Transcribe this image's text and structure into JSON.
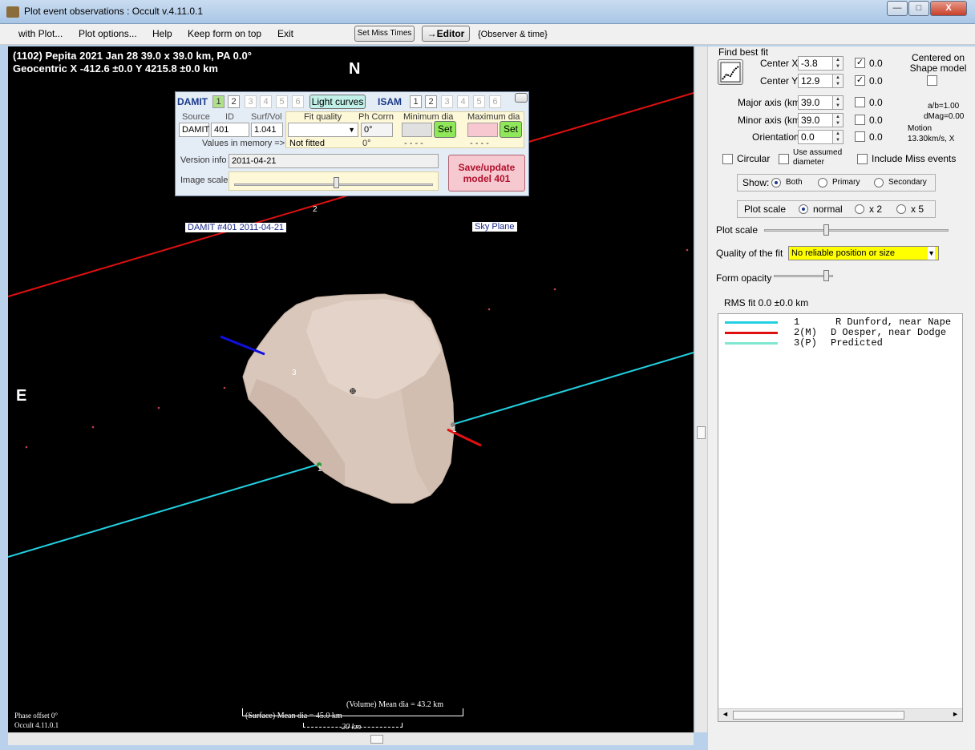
{
  "window": {
    "title": "Plot event observations : Occult v.4.11.0.1",
    "minimize": "—",
    "maximize": "□",
    "close": "X"
  },
  "menu": {
    "items": [
      "with Plot...",
      "Plot options...",
      "Help",
      "Keep form on top",
      "Exit"
    ],
    "set_miss_times": "Set Miss Times",
    "editor": "→Editor",
    "observer_time": "{Observer & time}"
  },
  "plot": {
    "header_line1": "(1102) Pepita  2021 Jan 28   39.0 x 39.0 km, PA 0.0°",
    "header_line2": "Geocentric  X  -412.6 ±0.0  Y 4215.8 ±0.0 km",
    "north": "N",
    "east": "E",
    "damit_label": "DAMIT #401 2011-04-21",
    "sky_plane": "Sky Plane",
    "chord_labels": [
      "1",
      "1",
      "2",
      "3"
    ],
    "phase_offset": "Phase offset 0°",
    "version": "Occult 4.11.0.1",
    "volume_mean": "(Volume) Mean dia = 43.2 km",
    "surface_mean": "(Surface) Mean dia = 45.0 km",
    "scale_bar": "20 km",
    "colors": {
      "chord1": "#22d0e0",
      "chord2": "#e01010",
      "predicted": "#7fe8d0",
      "asteroid": "#dac7bc"
    }
  },
  "damit_panel": {
    "damit_label": "DAMIT",
    "isam_label": "ISAM",
    "damit_nums": [
      "1",
      "2",
      "3",
      "4",
      "5",
      "6"
    ],
    "isam_nums": [
      "1",
      "2",
      "3",
      "4",
      "5",
      "6"
    ],
    "light_curves": "Light curves",
    "col_source": "Source",
    "col_id": "ID",
    "col_surfvol": "Surf/Vol",
    "col_fitq": "Fit quality",
    "col_phcorr": "Ph Corrn",
    "col_mindia": "Minimum dia",
    "col_maxdia": "Maximum dia",
    "source_val": "DAMIT",
    "id_val": "401",
    "surfvol_val": "1.041",
    "ph_val": "0°",
    "set": "Set",
    "values_in_memory": "Values in memory =>",
    "not_fitted": "Not fitted",
    "ph_mem": "0°",
    "dashes": "- - - -",
    "version_info_label": "Version info",
    "version_info_val": "2011-04-21",
    "image_scale_label": "Image scale",
    "save_update": "Save/update model 401"
  },
  "right_panel": {
    "find_best_fit": "Find best fit",
    "center_x_label": "Center X",
    "center_x": "-3.8",
    "center_y_label": "Center Y",
    "center_y": "12.9",
    "major_label": "Major axis (km)",
    "major": "39.0",
    "minor_label": "Minor axis (km)",
    "minor": "39.0",
    "orient_label": "Orientation",
    "orient": "0.0",
    "uncert": [
      "0.0",
      "0.0",
      "0.0",
      "0.0",
      "0.0"
    ],
    "centered_on": "Centered on Shape model",
    "ab_ratio": "a/b=1.00",
    "dmag": "dMag=0.00",
    "motion": "Motion",
    "motion_val": "13.30km/s, X",
    "circular": "Circular",
    "use_assumed": "Use assumed diameter",
    "include_miss": "Include Miss events",
    "show_label": "Show:",
    "show_both": "Both",
    "show_primary": "Primary",
    "show_secondary": "Secondary",
    "plot_scale_group": "Plot scale",
    "scale_normal": "normal",
    "scale_x2": "x 2",
    "scale_x5": "x 5",
    "plot_scale_label": "Plot scale",
    "quality_label": "Quality of the fit",
    "quality_val": "No reliable position or size",
    "form_opacity": "Form opacity",
    "rms_fit": "RMS fit 0.0 ±0.0 km",
    "legend": [
      {
        "num": "1",
        "text": "R Dunford, near Nape",
        "color": "#22d0e0"
      },
      {
        "num": "2(M)",
        "text": "D Oesper, near Dodge",
        "color": "#e01010"
      },
      {
        "num": "3(P)",
        "text": "Predicted",
        "color": "#7fe8d0"
      }
    ]
  }
}
